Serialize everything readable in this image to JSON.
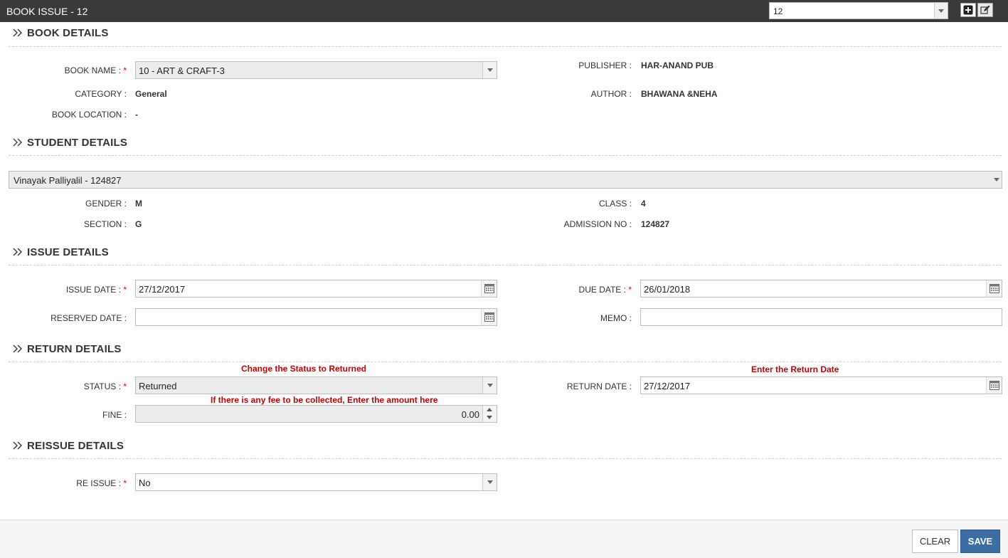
{
  "header": {
    "title": "BOOK ISSUE - 12",
    "record_value": "12"
  },
  "sections": {
    "book": "BOOK DETAILS",
    "student": "STUDENT DETAILS",
    "issue": "ISSUE DETAILS",
    "return": "RETURN DETAILS",
    "reissue": "REISSUE DETAILS"
  },
  "book": {
    "name_label": "BOOK NAME :",
    "name_value": "10 - ART & CRAFT-3",
    "category_label": "CATEGORY :",
    "category_value": "General",
    "location_label": "BOOK LOCATION :",
    "location_value": "-",
    "publisher_label": "PUBLISHER :",
    "publisher_value": "HAR-ANAND PUB",
    "author_label": "AUTHOR :",
    "author_value": "BHAWANA &NEHA"
  },
  "student": {
    "select_value": "Vinayak Palliyalil - 124827",
    "gender_label": "GENDER :",
    "gender_value": "M",
    "section_label": "SECTION :",
    "section_value": "G",
    "class_label": "CLASS :",
    "class_value": "4",
    "admission_label": "ADMISSION NO :",
    "admission_value": "124827"
  },
  "issue": {
    "issue_date_label": "ISSUE DATE :",
    "issue_date_value": "27/12/2017",
    "due_date_label": "DUE DATE :",
    "due_date_value": "26/01/2018",
    "reserved_date_label": "RESERVED DATE :",
    "reserved_date_value": "",
    "memo_label": "MEMO :",
    "memo_value": ""
  },
  "return": {
    "status_label": "STATUS :",
    "status_value": "Returned",
    "fine_label": "FINE :",
    "fine_value": "0.00",
    "return_date_label": "RETURN DATE :",
    "return_date_value": "27/12/2017",
    "note_status": "Change the Status to Returned",
    "note_fine": "If there is any fee to be collected, Enter the amount here",
    "note_return_date": "Enter the Return Date"
  },
  "reissue": {
    "label": "RE ISSUE :",
    "value": "No"
  },
  "required_mark": "*",
  "footer": {
    "clear_label": "CLEAR",
    "save_label": "SAVE"
  },
  "colors": {
    "titlebar": "#3a3a3a",
    "required": "#dd0000",
    "note": "#cc0000",
    "save_button": "#3a6ea5"
  }
}
